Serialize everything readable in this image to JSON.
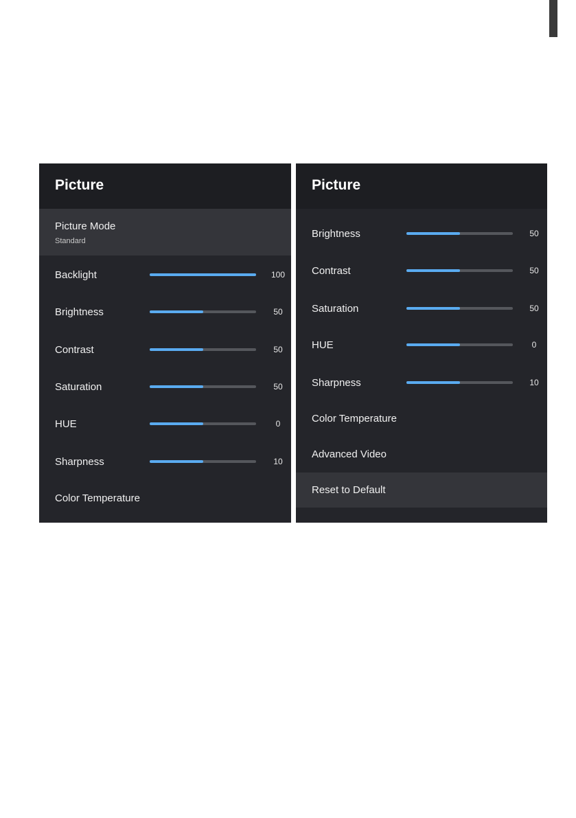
{
  "left_panel": {
    "title": "Picture",
    "picture_mode": {
      "label": "Picture Mode",
      "value": "Standard"
    },
    "sliders": [
      {
        "label": "Backlight",
        "value": "100",
        "level": 1.0
      },
      {
        "label": "Brightness",
        "value": "50",
        "level": 0.5
      },
      {
        "label": "Contrast",
        "value": "50",
        "level": 0.5
      },
      {
        "label": "Saturation",
        "value": "50",
        "level": 0.5
      },
      {
        "label": "HUE",
        "value": "0",
        "level": 0.5
      },
      {
        "label": "Sharpness",
        "value": "10",
        "level": 0.5
      }
    ],
    "items": [
      {
        "label": "Color Temperature"
      }
    ]
  },
  "right_panel": {
    "title": "Picture",
    "sliders": [
      {
        "label": "Brightness",
        "value": "50",
        "level": 0.5
      },
      {
        "label": "Contrast",
        "value": "50",
        "level": 0.5
      },
      {
        "label": "Saturation",
        "value": "50",
        "level": 0.5
      },
      {
        "label": "HUE",
        "value": "0",
        "level": 0.5
      },
      {
        "label": "Sharpness",
        "value": "10",
        "level": 0.5
      }
    ],
    "items": [
      {
        "label": "Color Temperature"
      },
      {
        "label": "Advanced Video"
      },
      {
        "label": "Reset to Default"
      }
    ]
  },
  "colors": {
    "panel_background": "#24252a",
    "header_background": "#1d1e22",
    "highlight_background": "#34353a",
    "slider_fill": "#5aabf0",
    "slider_track": "#55575c"
  }
}
